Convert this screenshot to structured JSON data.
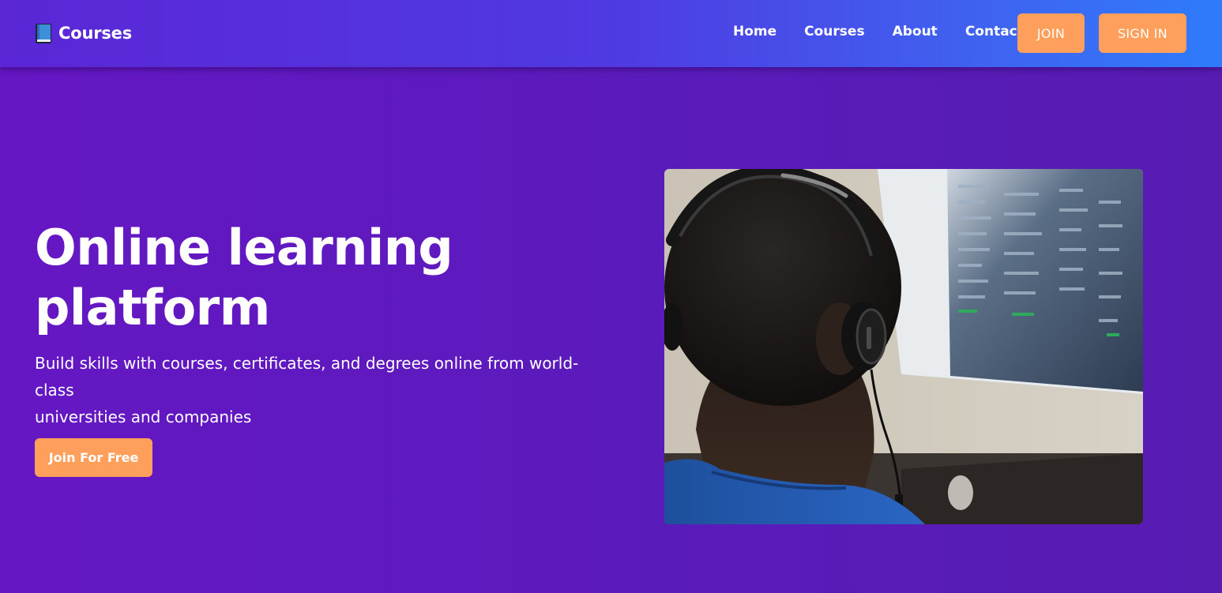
{
  "brand": {
    "name": "Courses",
    "icon": "book-icon"
  },
  "nav": {
    "links": [
      "Home",
      "Courses",
      "About",
      "Contact"
    ],
    "join_label": "JOIN",
    "signin_label": "SIGN IN"
  },
  "hero": {
    "title_line1": "Online learning",
    "title_line2": "platform",
    "subtitle_line1": "Build skills with courses, certificates, and degrees online from world-class",
    "subtitle_line2": "universities and companies",
    "cta_label": "Join For Free",
    "image_alt": "Student with headphones looking at a computer screen"
  },
  "colors": {
    "accent": "#ff9f5c",
    "header_start": "#5b26d6",
    "header_end": "#2e7cfb",
    "background": "#5e1ac0"
  }
}
